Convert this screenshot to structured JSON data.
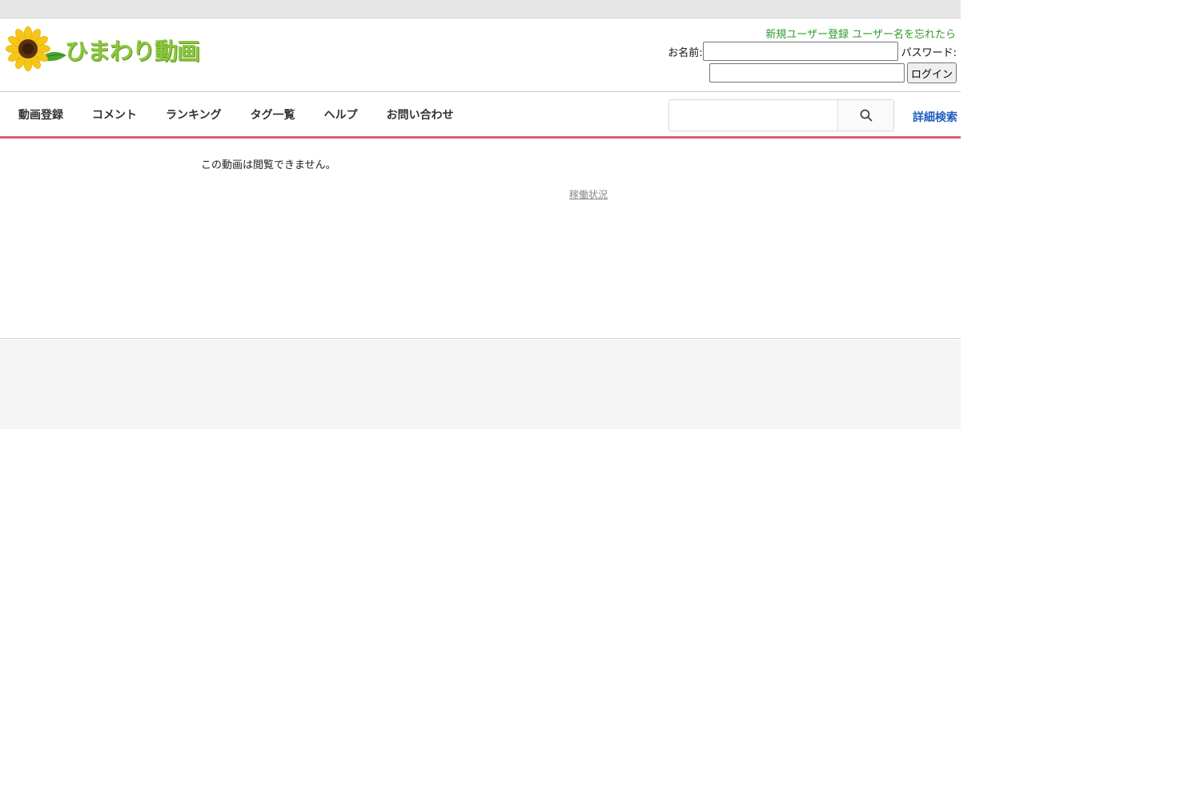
{
  "header": {
    "logo_text": "ひまわり動画",
    "links": {
      "register": "新規ユーザー登録",
      "forgot": "ユーザー名を忘れたら"
    },
    "login": {
      "name_label": "お名前:",
      "name_value": "",
      "password_label": "パスワード:",
      "password_value": "",
      "button": "ログイン"
    }
  },
  "nav": {
    "items": [
      {
        "label": "動画登録"
      },
      {
        "label": "コメント"
      },
      {
        "label": "ランキング"
      },
      {
        "label": "タグ一覧"
      },
      {
        "label": "ヘルプ"
      },
      {
        "label": "お問い合わせ"
      }
    ],
    "search_value": "",
    "search_icon": "search-icon",
    "advanced_search": "詳細検索"
  },
  "main": {
    "message": "この動画は閲覧できません。",
    "status_link": "稼働状況"
  },
  "colors": {
    "logo_green": "#8cc63f",
    "link_green": "#2e9a2e",
    "nav_underline": "#de5e6c",
    "link_blue": "#1f5fbf"
  }
}
